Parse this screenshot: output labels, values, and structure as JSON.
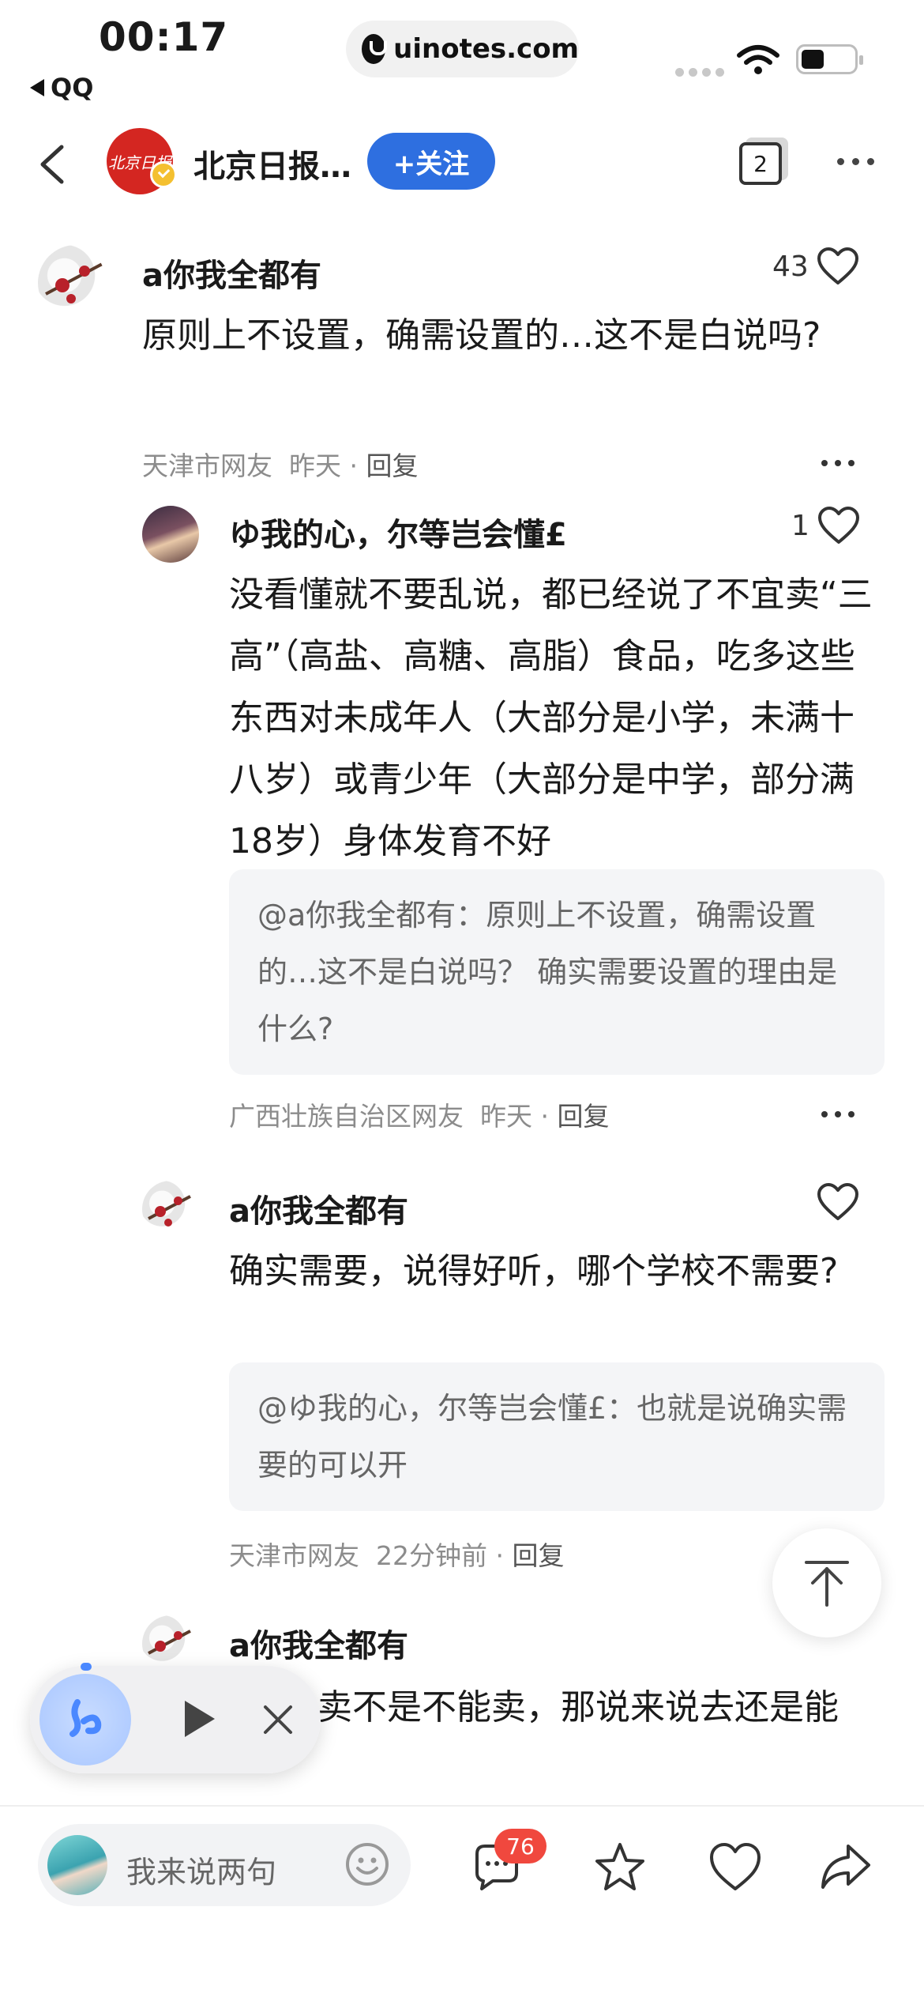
{
  "status_bar": {
    "time": "00:17",
    "back_app": "QQ",
    "url": "uinotes.com"
  },
  "header": {
    "logo_text": "北京日报",
    "outlet_name": "北京日报…",
    "follow_label": "+关注",
    "tab_count": "2"
  },
  "comments": [
    {
      "user": "a你我全都有",
      "likes": "43",
      "text": "原则上不设置，确需设置的…这不是白说吗?",
      "location": "天津市网友",
      "time": "昨天",
      "reply_label": "回复"
    },
    {
      "user": "ゆ我的心，尔等岂会懂£",
      "likes": "1",
      "text": "没看懂就不要乱说，都已经说了不宜卖“三高”（高盐、高糖、高脂）食品，吃多这些东西对未成年人（大部分是小学，未满十八岁）或青少年（大部分是中学，部分满18岁）身体发育不好",
      "quote": "@a你我全都有：原则上不设置，确需设置的…这不是白说吗？ 确实需要设置的理由是什么?",
      "location": "广西壮族自治区网友",
      "time": "昨天",
      "reply_label": "回复"
    },
    {
      "user": "a你我全都有",
      "likes": "",
      "text": "确实需要，说得好听，哪个学校不需要?",
      "quote": "@ゆ我的心，尔等岂会懂£：也就是说确实需要的可以开",
      "location": "天津市网友",
      "time": "22分钟前",
      "reply_label": "回复"
    },
    {
      "user": "a你我全都有",
      "text": "卖不是不能卖，那说来说去还是能"
    }
  ],
  "bottom_bar": {
    "input_placeholder": "我来说两句",
    "comment_count": "76"
  },
  "icons": {
    "like": "heart-icon",
    "more": "more-dots-icon",
    "back": "chevron-left-icon",
    "to_top": "arrow-up-top-icon",
    "share": "share-icon",
    "favorite": "star-icon"
  },
  "colors": {
    "accent": "#2e6fe0",
    "badge": "#f0483e",
    "logo": "#d42621"
  }
}
